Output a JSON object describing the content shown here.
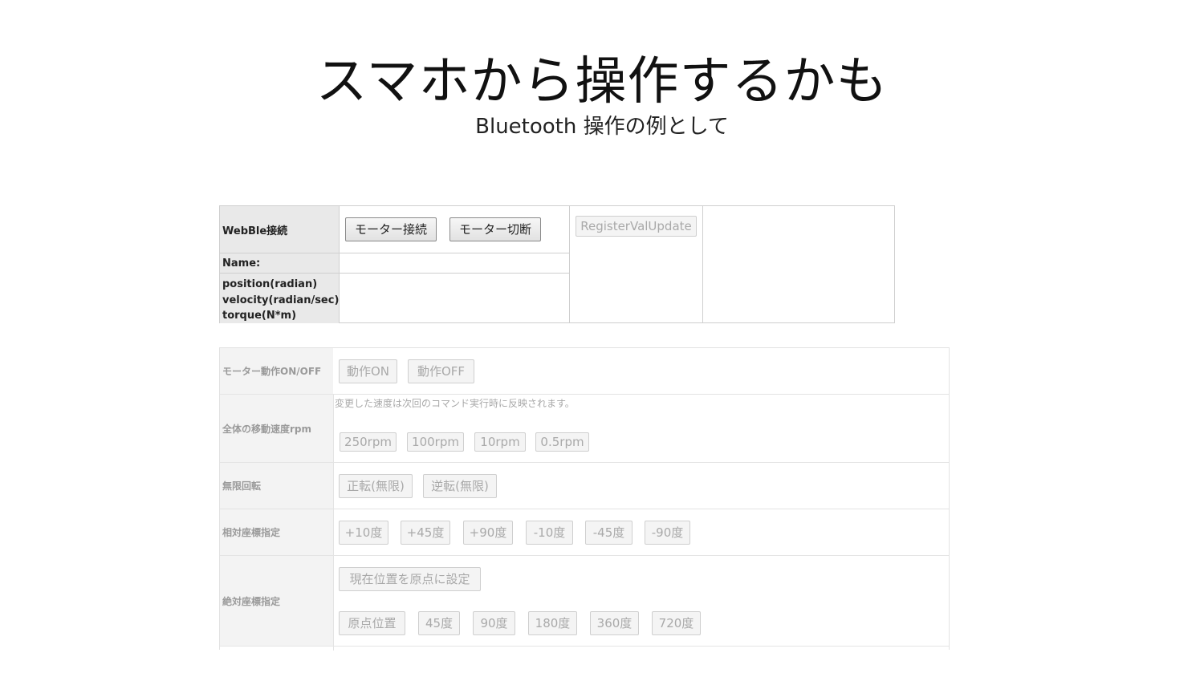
{
  "slide": {
    "title": "スマホから操作するかも",
    "subtitle": "Bluetooth 操作の例として"
  },
  "connection_panel": {
    "webble_label": "WebBle接続",
    "connect_button": "モーター接続",
    "disconnect_button": "モーター切断",
    "register_button": "RegisterValUpdate",
    "name_label": "Name:",
    "name_value": "",
    "status_labels": [
      "position(radian)",
      "velocity(radian/sec)",
      "torque(N*m)"
    ]
  },
  "control_panel": {
    "motor_onoff": {
      "label": "モーター動作ON/OFF",
      "buttons": [
        "動作ON",
        "動作OFF"
      ]
    },
    "speed": {
      "label": "全体の移動速度rpm",
      "note": "変更した速度は次回のコマンド実行時に反映されます。",
      "buttons": [
        "250rpm",
        "100rpm",
        "10rpm",
        "0.5rpm"
      ]
    },
    "infinite_rotation": {
      "label": "無限回転",
      "buttons": [
        "正転(無限)",
        "逆転(無限)"
      ]
    },
    "relative": {
      "label": "相対座標指定",
      "buttons": [
        "+10度",
        "+45度",
        "+90度",
        "-10度",
        "-45度",
        "-90度"
      ]
    },
    "absolute": {
      "label": "絶対座標指定",
      "origin_button": "現在位置を原点に設定",
      "buttons": [
        "原点位置",
        "45度",
        "90度",
        "180度",
        "360度",
        "720度"
      ]
    }
  }
}
